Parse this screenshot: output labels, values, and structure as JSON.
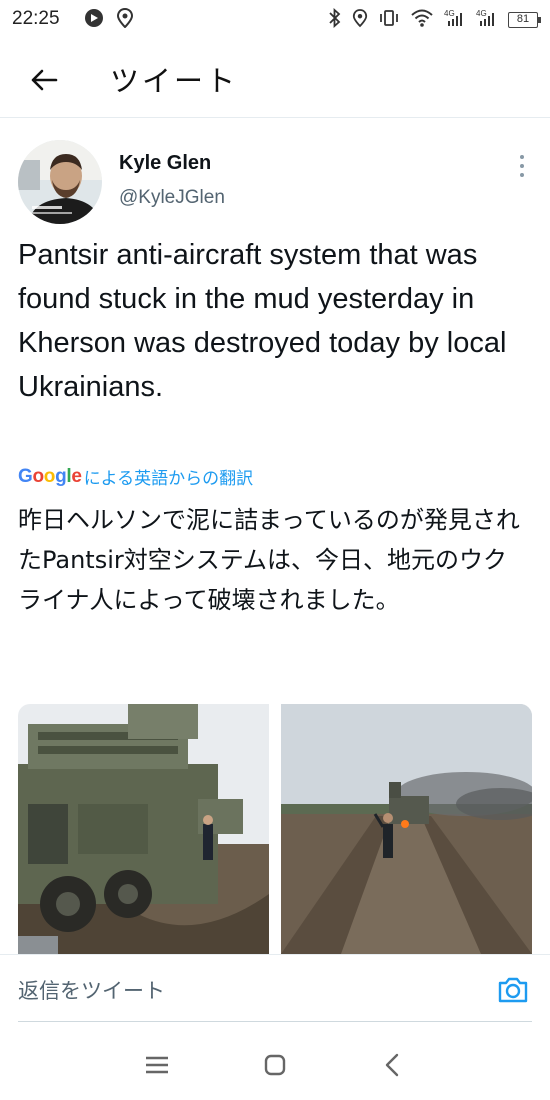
{
  "status_bar": {
    "time": "22:25",
    "battery": "81",
    "icons": [
      "media-icon",
      "location-icon",
      "bluetooth-icon",
      "location-icon",
      "vibrate-icon",
      "wifi-icon",
      "signal-4g-icon",
      "signal-4g-icon",
      "battery-icon"
    ]
  },
  "header": {
    "title": "ツイート",
    "back_icon": "arrow-left-icon"
  },
  "tweet": {
    "author_name": "Kyle Glen",
    "author_handle": "@KyleJGlen",
    "text": "Pantsir anti-aircraft system that was found stuck in the mud yesterday in Kherson was destroyed today by local Ukrainians.",
    "translation": {
      "provider": "Google",
      "label": "による英語からの翻訳",
      "text": "昨日ヘルソンで泥に詰まっているのが発見されたPantsir対空システムは、今日、地元のウクライナ人によって破壊されました。"
    },
    "media": [
      {
        "name": "tweet-photo-1"
      },
      {
        "name": "tweet-photo-2"
      }
    ]
  },
  "reply": {
    "placeholder": "返信をツイート",
    "camera_icon": "camera-icon"
  },
  "navbar": {
    "icons": [
      "menu-icon",
      "home-square-icon",
      "back-chevron-icon"
    ]
  },
  "colors": {
    "accent": "#1d9bf0",
    "text_primary": "#0f1419",
    "text_secondary": "#536471",
    "divider": "#e6ecf0"
  }
}
